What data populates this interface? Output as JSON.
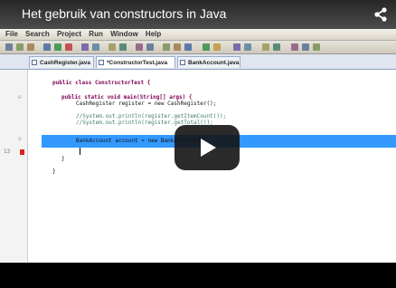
{
  "video": {
    "title": "Het gebruik van constructors in Java"
  },
  "ide": {
    "menu": [
      "File",
      "Search",
      "Project",
      "Run",
      "Window",
      "Help"
    ],
    "tabs": [
      {
        "label": "CashRegister.java",
        "active": false
      },
      {
        "label": "*ConstructorTest.java",
        "active": true
      },
      {
        "label": "BankAccount.java",
        "active": false
      }
    ],
    "code_lines": {
      "l1": "public class ConstructorTest {",
      "l2": "public static void main(String[] args) {",
      "l3": "CashRegister register = new CashRegister();",
      "l4": "//System.out.println(register.getItemCount());",
      "l5": "//System.out.println(register.getTotal());",
      "l6": "BankAccount account = new BankAccount(",
      "l7": "}",
      "l8": "}"
    },
    "gutter_marks": [
      "13"
    ]
  },
  "colors": {
    "highlight": "#3399ff",
    "keyword": "#7f0055",
    "comment": "#3f7f5f"
  },
  "icons": {
    "share": "share-icon",
    "play": "play-icon"
  }
}
